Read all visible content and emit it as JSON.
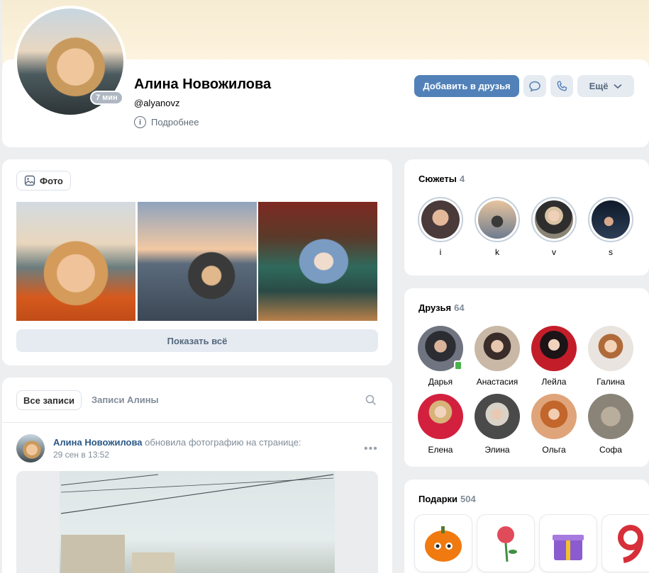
{
  "profile": {
    "name": "Алина Новожилова",
    "handle": "@alyanovz",
    "details_label": "Подробнее",
    "online_badge": "7 мин"
  },
  "actions": {
    "add_friend": "Добавить в друзья",
    "more": "Ещё"
  },
  "photos": {
    "chip_label": "Фото",
    "show_all": "Показать всё"
  },
  "wall": {
    "tab_all": "Все записи",
    "tab_own": "Записи Алины",
    "post": {
      "author": "Алина Новожилова",
      "action": "обновила фотографию на странице:",
      "date": "29 сен в 13:52"
    }
  },
  "stories": {
    "title": "Сюжеты",
    "count": "4",
    "items": [
      {
        "label": "i",
        "color": "#4a3a3a"
      },
      {
        "label": "k",
        "color": "#6e7c8f"
      },
      {
        "label": "v",
        "color": "#8a8476"
      },
      {
        "label": "s",
        "color": "#1e2a3a"
      }
    ]
  },
  "friends": {
    "title": "Друзья",
    "count": "64",
    "items": [
      {
        "name": "Дарья",
        "mobile": true,
        "color": "#3d3f45"
      },
      {
        "name": "Анастасия",
        "color": "#9b8a7c"
      },
      {
        "name": "Лейла",
        "color": "#b0202a"
      },
      {
        "name": "Галина",
        "color": "#c8ab8a"
      },
      {
        "name": "Елена",
        "color": "#c82042"
      },
      {
        "name": "Элина",
        "color": "#6a6a6a"
      },
      {
        "name": "Ольга",
        "color": "#b8723e"
      },
      {
        "name": "Софа",
        "color": "#8a8478"
      }
    ]
  },
  "gifts": {
    "title": "Подарки",
    "count": "504",
    "items": [
      "pumpkin-gift-icon",
      "rose-gift-icon",
      "giftbox-gift-icon",
      "nine-balloon-gift-icon"
    ]
  },
  "colors": {
    "accent": "#5181b8",
    "link": "#2a5885",
    "muted": "#818c99",
    "page_bg": "#edeef0"
  }
}
